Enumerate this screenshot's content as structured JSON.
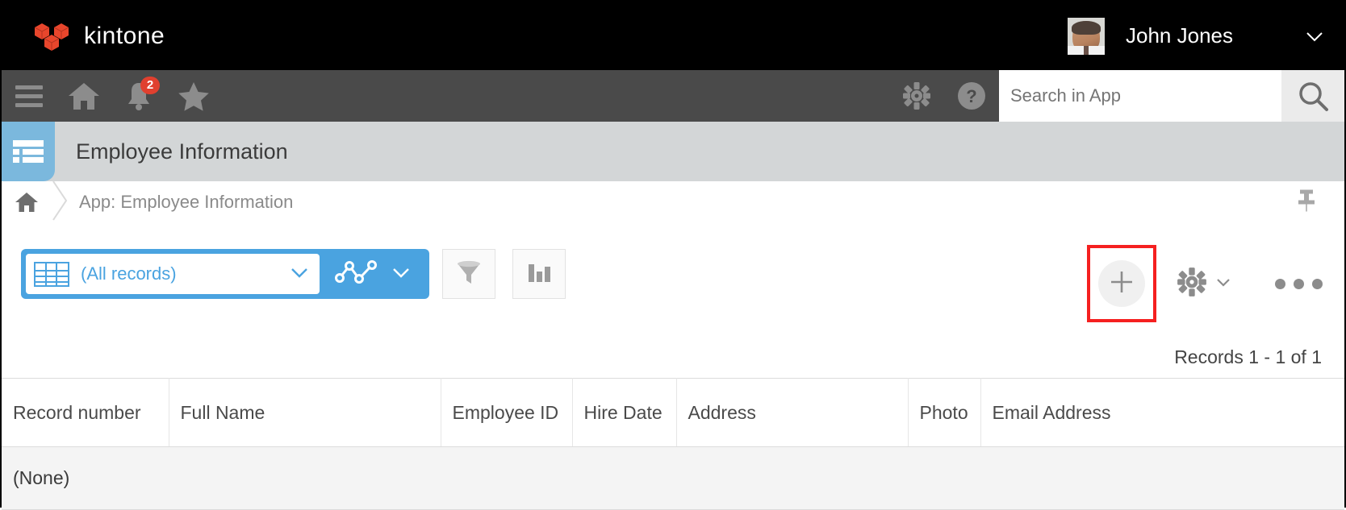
{
  "topbar": {
    "brand": "kintone",
    "logo_color": "#e8462c",
    "user_name": "John Jones",
    "caret_icon": "chevron-down-icon"
  },
  "navbar": {
    "menu_icon": "hamburger-menu-icon",
    "home_icon": "home-icon",
    "notifications_icon": "bell-icon",
    "notifications_badge": "2",
    "favorites_icon": "star-icon",
    "settings_icon": "gear-icon",
    "help_icon": "question-mark-icon",
    "search_placeholder": "Search in App",
    "search_value": "",
    "search_icon": "magnifier-icon",
    "badge_color": "#e0402f"
  },
  "app": {
    "icon": "app-list-icon",
    "icon_color": "#7bb8dd",
    "title": "Employee Information"
  },
  "breadcrumb": {
    "home_icon": "home-icon",
    "separator_icon": "chevron-right-icon",
    "path": "App: Employee Information",
    "pin_icon": "pushpin-icon"
  },
  "toolbar": {
    "view_icon": "table-grid-icon",
    "view_label": "(All records)",
    "view_caret_icon": "chevron-down-icon",
    "chart_view_icon": "line-graph-icon",
    "chart_caret_icon": "chevron-down-icon",
    "filter_icon": "funnel-filter-icon",
    "bar_chart_icon": "bar-chart-icon",
    "add_record_icon": "plus-icon",
    "add_record_highlight_color": "#f52020",
    "settings_icon": "gear-icon",
    "settings_caret_icon": "chevron-down-icon",
    "more_icon": "ellipsis-icon",
    "accent_color": "#4aa3e0"
  },
  "records": {
    "count_text": "Records 1 - 1 of 1",
    "columns": [
      "Record number",
      "Full Name",
      "Employee ID",
      "Hire Date",
      "Address",
      "Photo",
      "Email Address"
    ],
    "empty_text": "(None)"
  }
}
